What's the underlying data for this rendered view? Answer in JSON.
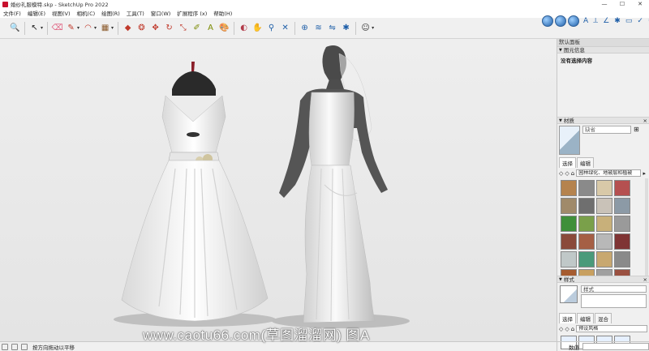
{
  "window": {
    "title": "婚纱礼服模特.skp - SketchUp Pro 2022",
    "controls": [
      "—",
      "☐",
      "✕"
    ]
  },
  "menu": [
    "文件(F)",
    "编辑(E)",
    "视图(V)",
    "相机(C)",
    "绘图(R)",
    "工具(T)",
    "窗口(W)",
    "扩展程序 (x)",
    "帮助(H)"
  ],
  "toolbar": {
    "tools": [
      {
        "name": "zoom-extents-icon",
        "glyph": "🔍"
      },
      {
        "name": "select-icon",
        "glyph": "↖"
      },
      {
        "name": "eraser-icon",
        "glyph": "⌫",
        "color": "#e06080"
      },
      {
        "name": "pencil-icon",
        "glyph": "✎",
        "color": "#c0392b"
      },
      {
        "name": "arc-icon",
        "glyph": "◠",
        "color": "#c0392b"
      },
      {
        "name": "shape-icon",
        "glyph": "▦",
        "color": "#8b5a2b"
      },
      {
        "name": "push-pull-icon",
        "glyph": "◆",
        "color": "#c0392b"
      },
      {
        "name": "offset-icon",
        "glyph": "❂",
        "color": "#c0392b"
      },
      {
        "name": "move-icon",
        "glyph": "✥",
        "color": "#c0392b"
      },
      {
        "name": "rotate-icon",
        "glyph": "↻",
        "color": "#c0392b"
      },
      {
        "name": "scale-icon",
        "glyph": "⤡",
        "color": "#c0392b"
      },
      {
        "name": "tape-measure-icon",
        "glyph": "✐",
        "color": "#7a8a00"
      },
      {
        "name": "text-icon",
        "glyph": "A",
        "color": "#7a8a00"
      },
      {
        "name": "paint-bucket-icon",
        "glyph": "🎨"
      },
      {
        "name": "orbit-icon",
        "glyph": "◐",
        "color": "#b23a48"
      },
      {
        "name": "pan-icon",
        "glyph": "✋",
        "color": "#1f5fa8"
      },
      {
        "name": "zoom-icon",
        "glyph": "⚲",
        "color": "#1f5fa8"
      },
      {
        "name": "zoom-window-icon",
        "glyph": "✕",
        "color": "#1f5fa8"
      },
      {
        "name": "section-icon",
        "glyph": "⊕",
        "color": "#1f5fa8"
      },
      {
        "name": "warehouse-icon",
        "glyph": "≋",
        "color": "#1f5fa8"
      },
      {
        "name": "extension-icon",
        "glyph": "⇋",
        "color": "#1f5fa8"
      },
      {
        "name": "component-icon",
        "glyph": "✱",
        "color": "#1f5fa8"
      },
      {
        "name": "user-icon",
        "glyph": "☺",
        "color": "#333333"
      }
    ]
  },
  "tray": {
    "title": "默认面板",
    "entity_info": {
      "title": "图元信息",
      "empty_label": "没有选择内容"
    },
    "materials": {
      "title": "材质",
      "current_name": "缺省",
      "tabs": [
        "选择",
        "编辑"
      ],
      "library": "园林绿化、地被层和植被",
      "swatches": [
        "#b5834e",
        "#8a8a8a",
        "#d8c9a8",
        "#b55050",
        "#a08a6a",
        "#6f6f6f",
        "#c9c2b8",
        "#8c9aa6",
        "#3f8f3a",
        "#7aa04a",
        "#c8b07a",
        "#9a9a9a",
        "#8a4a3a",
        "#a55f45",
        "#b8b8b8",
        "#7f3434",
        "#c0c8c8",
        "#4a9a7a",
        "#c8a870",
        "#8a8a8a",
        "#a65c30",
        "#c8a060",
        "#a0a0a0",
        "#9a5040"
      ]
    },
    "styles": {
      "title": "样式",
      "name": "样式",
      "tabs": [
        "选择",
        "编辑",
        "混合"
      ],
      "library": "预设风格"
    }
  },
  "status": {
    "message": "按方向拖动以平移",
    "measure_label": "数值"
  },
  "watermark": "www.caotu66.com(草图溜溜网) 图A"
}
